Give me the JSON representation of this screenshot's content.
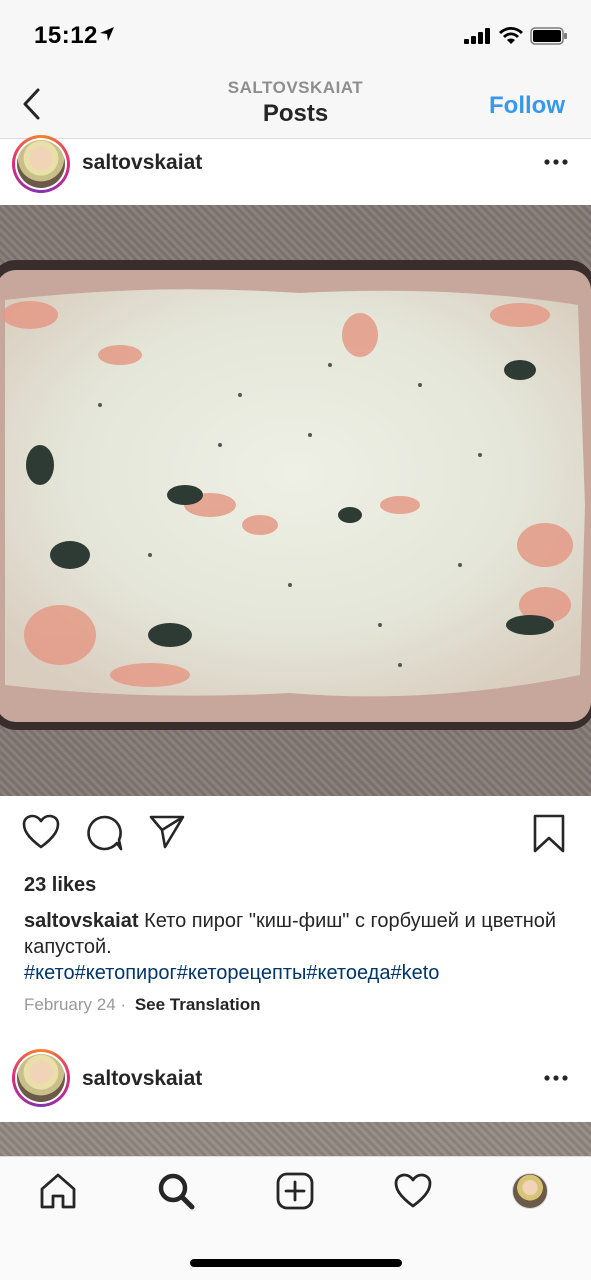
{
  "status_bar": {
    "time": "15:12"
  },
  "nav": {
    "subtitle": "SALTOVSKAIAT",
    "title": "Posts",
    "follow_label": "Follow"
  },
  "post": {
    "username": "saltovskaiat",
    "likes": "23 likes",
    "caption_user": "saltovskaiat",
    "caption_text": " Кето пирог \"киш-фиш\" с горбушей и цветной капустой.",
    "hashtags": "#кето#кетопирог#кеторецепты#кетоеда#keto",
    "date": "February 24",
    "separator": "·",
    "see_translation": "See Translation"
  },
  "next_post": {
    "username": "saltovskaiat"
  },
  "icons": {
    "back": "chevron-left-icon",
    "more": "more-options-icon",
    "like": "heart-icon",
    "comment": "comment-icon",
    "share": "send-icon",
    "save": "bookmark-icon",
    "home": "home-icon",
    "search": "search-icon",
    "new_post": "plus-square-icon",
    "activity": "heart-icon",
    "profile": "avatar"
  },
  "colors": {
    "accent": "#3897f0",
    "hashtag": "#003569",
    "text": "#262626",
    "muted": "#999999"
  }
}
